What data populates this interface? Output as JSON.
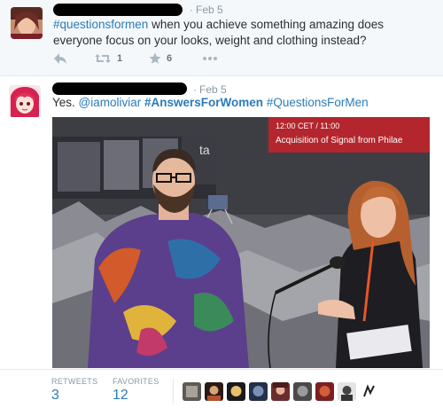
{
  "tweet1": {
    "time": "Feb 5",
    "hashtag": "#questionsformen",
    "text_rest": " when you achieve something amazing does everyone focus on your looks, weight and clothing instead?",
    "retweet_count": "1",
    "favorite_count": "6",
    "more_icon": "ellipsis-icon"
  },
  "tweet2": {
    "time": "Feb 5",
    "text_lead": "Yes. ",
    "mention": "@iamoliviar",
    "hashtag_bold": "#AnswersForWomen",
    "hashtag2": "#QuestionsForMen",
    "media": {
      "screen_line1": "12:00 CET / 11:00",
      "screen_line2": "Acquisition of Signal from Philae",
      "wall_text": "ta"
    },
    "stats": {
      "retweets_label": "RETWEETS",
      "retweets_value": "3",
      "favorites_label": "FAVORITES",
      "favorites_value": "12"
    }
  },
  "colors": {
    "link": "#2b7bb9",
    "meta": "#8899a6",
    "icon": "#aab8c2",
    "screen_red": "#b3262d"
  }
}
